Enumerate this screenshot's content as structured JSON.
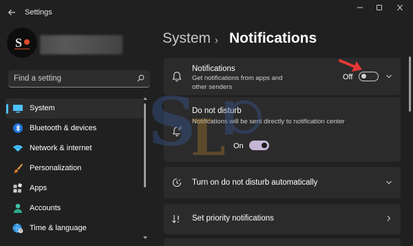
{
  "window": {
    "title": "Settings",
    "back_icon": "back-arrow-icon"
  },
  "profile": {
    "avatar_text": "S"
  },
  "search": {
    "placeholder": "Find a setting",
    "icon": "search-icon"
  },
  "sidebar": {
    "items": [
      {
        "label": "System",
        "icon": "monitor-icon",
        "active": true
      },
      {
        "label": "Bluetooth & devices",
        "icon": "bluetooth-icon"
      },
      {
        "label": "Network & internet",
        "icon": "wifi-icon"
      },
      {
        "label": "Personalization",
        "icon": "brush-icon"
      },
      {
        "label": "Apps",
        "icon": "apps-icon"
      },
      {
        "label": "Accounts",
        "icon": "person-icon"
      },
      {
        "label": "Time & language",
        "icon": "globe-clock-icon"
      }
    ]
  },
  "header": {
    "breadcrumb_root": "System",
    "separator": "›",
    "page_title": "Notifications"
  },
  "settings": {
    "notifications": {
      "title": "Notifications",
      "description": "Get notifications from apps and other senders",
      "toggle_state": "Off",
      "icon": "bell-icon"
    },
    "do_not_disturb": {
      "title": "Do not disturb",
      "description": "Notifications will be sent directly to notification center",
      "toggle_state": "On",
      "icon": "bell-snooze-icon"
    },
    "auto_dnd": {
      "title": "Turn on do not disturb automatically",
      "icon": "clock-snooze-icon"
    },
    "priority": {
      "title": "Set priority notifications",
      "icon": "priority-sort-icon"
    }
  },
  "colors": {
    "accent": "#4cc2ff",
    "toggle_on": "#c5b6d6",
    "annotation_arrow": "#e53935",
    "background": "#202020",
    "card": "#2b2b2b"
  }
}
